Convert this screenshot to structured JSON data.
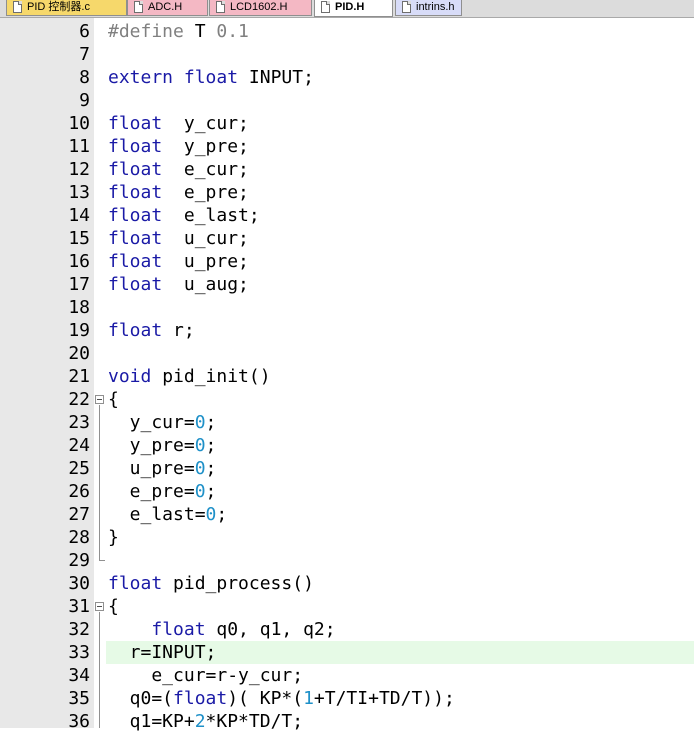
{
  "tabs": [
    {
      "label": "PID 控制器.c",
      "color": "#f6d86b"
    },
    {
      "label": "ADC.H",
      "color": "#f4b8c4"
    },
    {
      "label": "LCD1602.H",
      "color": "#f4b8c4"
    },
    {
      "label": "PID.H",
      "color": "#ffffff",
      "active": true
    },
    {
      "label": "intrins.h",
      "color": "#d8dcf8"
    }
  ],
  "highlighted_line": 33,
  "lines": [
    {
      "n": "6",
      "tokens": [
        [
          "pp",
          "#define"
        ],
        [
          "t",
          " T "
        ],
        [
          "pp",
          "0.1"
        ]
      ]
    },
    {
      "n": "7",
      "tokens": []
    },
    {
      "n": "8",
      "tokens": [
        [
          "kw",
          "extern"
        ],
        [
          "t",
          " "
        ],
        [
          "kw",
          "float"
        ],
        [
          "t",
          " INPUT;"
        ]
      ]
    },
    {
      "n": "9",
      "tokens": []
    },
    {
      "n": "10",
      "tokens": [
        [
          "kw",
          "float"
        ],
        [
          "t",
          "  y_cur;"
        ]
      ]
    },
    {
      "n": "11",
      "tokens": [
        [
          "kw",
          "float"
        ],
        [
          "t",
          "  y_pre;"
        ]
      ]
    },
    {
      "n": "12",
      "tokens": [
        [
          "kw",
          "float"
        ],
        [
          "t",
          "  e_cur;"
        ]
      ]
    },
    {
      "n": "13",
      "tokens": [
        [
          "kw",
          "float"
        ],
        [
          "t",
          "  e_pre;"
        ]
      ]
    },
    {
      "n": "14",
      "tokens": [
        [
          "kw",
          "float"
        ],
        [
          "t",
          "  e_last;"
        ]
      ]
    },
    {
      "n": "15",
      "tokens": [
        [
          "kw",
          "float"
        ],
        [
          "t",
          "  u_cur;"
        ]
      ]
    },
    {
      "n": "16",
      "tokens": [
        [
          "kw",
          "float"
        ],
        [
          "t",
          "  u_pre;"
        ]
      ]
    },
    {
      "n": "17",
      "tokens": [
        [
          "kw",
          "float"
        ],
        [
          "t",
          "  u_aug;"
        ]
      ]
    },
    {
      "n": "18",
      "tokens": []
    },
    {
      "n": "19",
      "tokens": [
        [
          "kw",
          "float"
        ],
        [
          "t",
          " r;"
        ]
      ]
    },
    {
      "n": "20",
      "tokens": []
    },
    {
      "n": "21",
      "tokens": [
        [
          "kw",
          "void"
        ],
        [
          "t",
          " pid_init()"
        ]
      ]
    },
    {
      "n": "22",
      "tokens": [
        [
          "t",
          "{"
        ]
      ]
    },
    {
      "n": "23",
      "tokens": [
        [
          "t",
          "  y_cur="
        ],
        [
          "num",
          "0"
        ],
        [
          "t",
          ";"
        ]
      ]
    },
    {
      "n": "24",
      "tokens": [
        [
          "t",
          "  y_pre="
        ],
        [
          "num",
          "0"
        ],
        [
          "t",
          ";"
        ]
      ]
    },
    {
      "n": "25",
      "tokens": [
        [
          "t",
          "  u_pre="
        ],
        [
          "num",
          "0"
        ],
        [
          "t",
          ";"
        ]
      ]
    },
    {
      "n": "26",
      "tokens": [
        [
          "t",
          "  e_pre="
        ],
        [
          "num",
          "0"
        ],
        [
          "t",
          ";"
        ]
      ]
    },
    {
      "n": "27",
      "tokens": [
        [
          "t",
          "  e_last="
        ],
        [
          "num",
          "0"
        ],
        [
          "t",
          ";"
        ]
      ]
    },
    {
      "n": "28",
      "tokens": [
        [
          "t",
          "}"
        ]
      ]
    },
    {
      "n": "29",
      "tokens": []
    },
    {
      "n": "30",
      "tokens": [
        [
          "kw",
          "float"
        ],
        [
          "t",
          " pid_process()"
        ]
      ]
    },
    {
      "n": "31",
      "tokens": [
        [
          "t",
          "{"
        ]
      ]
    },
    {
      "n": "32",
      "tokens": [
        [
          "t",
          "    "
        ],
        [
          "kw",
          "float"
        ],
        [
          "t",
          " q0, q1, q2;"
        ]
      ]
    },
    {
      "n": "33",
      "tokens": [
        [
          "t",
          "  r=INPUT;"
        ]
      ]
    },
    {
      "n": "34",
      "tokens": [
        [
          "t",
          "    e_cur=r-y_cur;"
        ]
      ]
    },
    {
      "n": "35",
      "tokens": [
        [
          "t",
          "  q0=("
        ],
        [
          "kw",
          "float"
        ],
        [
          "t",
          ")( KP*("
        ],
        [
          "num",
          "1"
        ],
        [
          "t",
          "+T/TI+TD/T));"
        ]
      ]
    },
    {
      "n": "36",
      "tokens": [
        [
          "t",
          "  q1=KP+"
        ],
        [
          "num",
          "2"
        ],
        [
          "t",
          "*KP*TD/T;"
        ]
      ]
    }
  ]
}
